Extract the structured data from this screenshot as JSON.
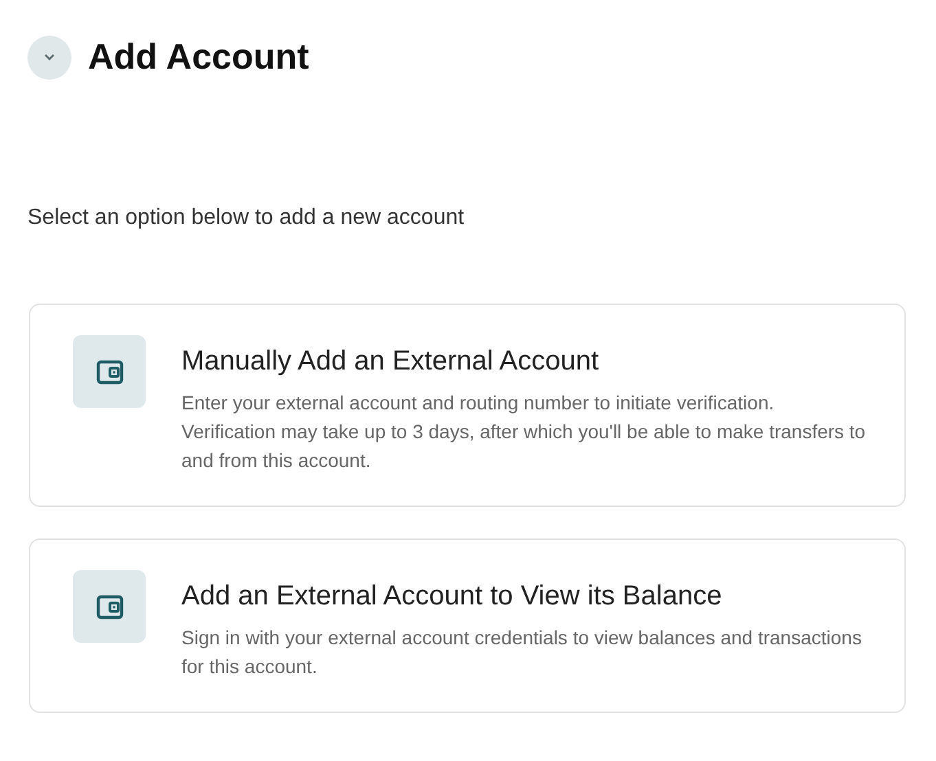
{
  "header": {
    "title": "Add Account"
  },
  "instruction": "Select an option below to add a new account",
  "options": [
    {
      "title": "Manually Add an External Account",
      "description": "Enter your external account and routing number to initiate verification. Verification may take up to 3 days, after which you'll be able to make transfers to and from this account."
    },
    {
      "title": "Add an External Account to View its Balance",
      "description": "Sign in with your external account credentials to view balances and transactions for this account."
    }
  ]
}
